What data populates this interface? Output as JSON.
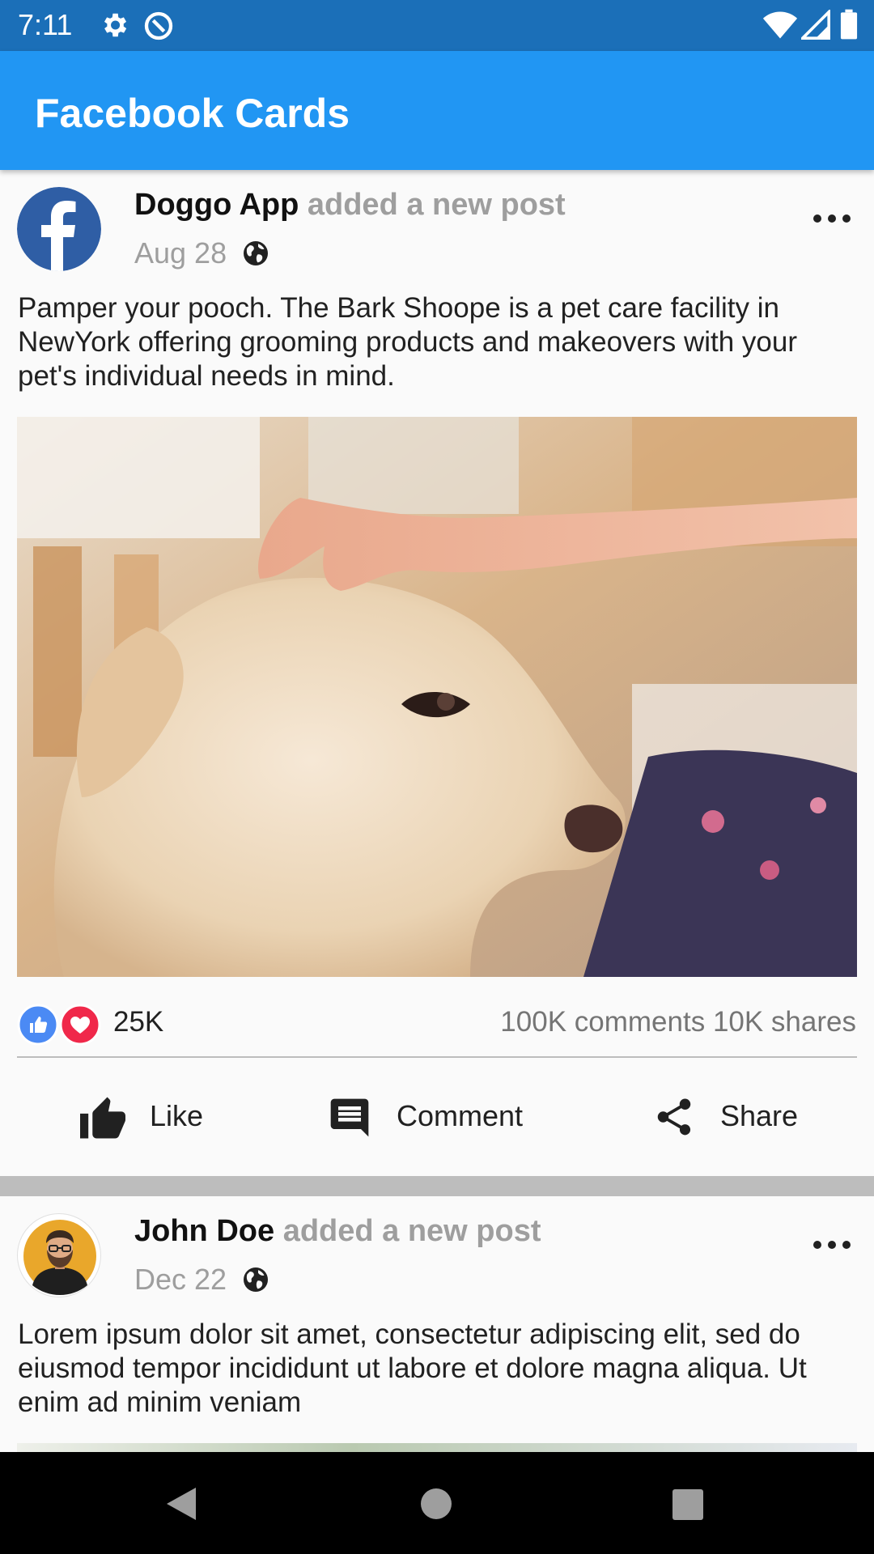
{
  "status_bar": {
    "time": "7:11"
  },
  "app_bar": {
    "title": "Facebook Cards"
  },
  "posts": [
    {
      "author": "Doggo App",
      "action": "added a new post",
      "date": "Aug 28",
      "text": "Pamper your pooch. The Bark Shoope is a pet care facility in NewYork offering grooming products and makeovers with your pet's individual needs in mind.",
      "likes": "25K",
      "comments": "100K comments",
      "shares": "10K shares",
      "actions": {
        "like": "Like",
        "comment": "Comment",
        "share": "Share"
      }
    },
    {
      "author": "John Doe",
      "action": "added a new post",
      "date": "Dec 22",
      "text": "Lorem ipsum dolor sit amet, consectetur adipiscing elit, sed do eiusmod tempor incididunt ut labore et dolore magna aliqua. Ut enim ad minim veniam"
    }
  ],
  "colors": {
    "status_bar": "#1b6fb8",
    "app_bar": "#2196f3",
    "like_blue": "#4b8af4",
    "love_red": "#f0284a"
  }
}
